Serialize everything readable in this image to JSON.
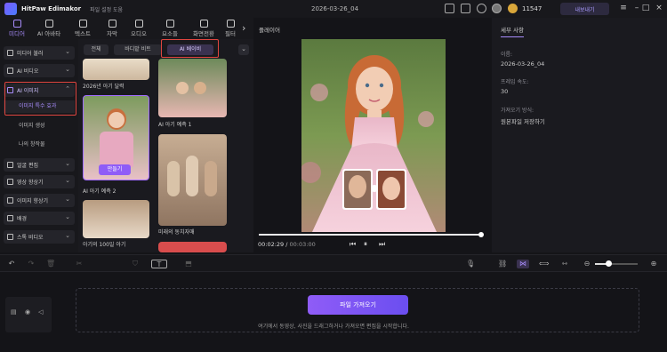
{
  "app": {
    "name": "HitPaw Edimakor",
    "menu": "파일  설정  도움",
    "doc_title": "2026-03-26_04",
    "credits": "11547",
    "upgrade_label": "내보내기"
  },
  "top_tabs": [
    {
      "label": "미디어",
      "icon": "media-icon"
    },
    {
      "label": "AI 아바타",
      "icon": "avatar-icon"
    },
    {
      "label": "텍스트",
      "icon": "text-icon"
    },
    {
      "label": "자막",
      "icon": "subtitle-icon"
    },
    {
      "label": "오디오",
      "icon": "audio-icon"
    },
    {
      "label": "요소들",
      "icon": "elements-icon"
    },
    {
      "label": "화면전환",
      "icon": "transition-icon"
    },
    {
      "label": "필터",
      "icon": "filter-icon"
    }
  ],
  "left_nav": {
    "items": [
      {
        "label": "미디어 불러",
        "icon": "import-icon"
      },
      {
        "label": "AI 비디오",
        "icon": "ai-video-icon"
      },
      {
        "label": "AI 이미지",
        "icon": "ai-image-icon"
      }
    ],
    "sub_items": [
      "이미지 특수 효과",
      "이미지 생성",
      "나의 창작물"
    ],
    "more_items": [
      {
        "label": "얼굴 편집",
        "icon": "face-icon"
      },
      {
        "label": "영상 향상기",
        "icon": "enhance-icon"
      },
      {
        "label": "이미지 향상기",
        "icon": "image-enhance-icon"
      },
      {
        "label": "배경",
        "icon": "background-icon"
      },
      {
        "label": "스톡 비디오",
        "icon": "stock-icon"
      }
    ]
  },
  "filters": [
    "전체",
    "바디밭 비트",
    "AI 베이비"
  ],
  "templates": [
    {
      "label": "2026년 아기 달력"
    },
    {
      "label": "AI 아기 예측 1"
    },
    {
      "label": "AI 아기 예측 2",
      "button": "만들기"
    },
    {
      "label": "미래의 동치자매"
    },
    {
      "label": "아기의 100일 아기"
    }
  ],
  "player": {
    "title": "플레이어",
    "current_time": "00:02:29",
    "total_time": "00:03:00",
    "progress": 0.99
  },
  "properties": {
    "tab": "세부 사항",
    "name_label": "이름:",
    "name_value": "2026-03-26_04",
    "fps_label": "프레임 속도:",
    "fps_value": "30",
    "import_label": "가져오기 방식:",
    "import_value": "원본파일 저장하기"
  },
  "timeline": {
    "import_button": "파일 가져오기",
    "hint": "여기에서 동영상, 사진을 드래그하거나 가져오면 편집을 시작합니다."
  },
  "colors": {
    "accent": "#a78bfa",
    "highlight": "#e0453f",
    "import_button": "#8f5cf7"
  }
}
